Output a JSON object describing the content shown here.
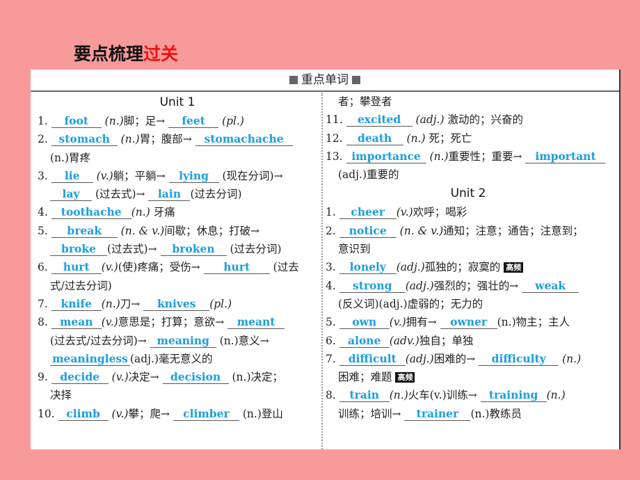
{
  "heading": {
    "black": "要点梳理",
    "red": "过关"
  },
  "section_title": "重点单词",
  "unit1": {
    "title": "Unit 1",
    "items": {
      "i1": {
        "num": "1.",
        "a": "foot",
        "pos": "(n.)",
        "meaning": "脚；足→",
        "b": "feet",
        "tail": "(pl.)"
      },
      "i2": {
        "num": "2.",
        "a": "stomach",
        "pos": "(n.)",
        "meaning": "胃；腹部→",
        "b": "stomachache",
        "cont": "(n.)胃疼"
      },
      "i3": {
        "num": "3.",
        "a": "lie",
        "pos": "(v.)",
        "meaning": "躺；平躺→",
        "b": "lying",
        "tail": "(现在分词)→",
        "c": "lay",
        "mid": "(过去式)→",
        "d": "lain",
        "tail2": "(过去分词)"
      },
      "i4": {
        "num": "4.",
        "a": "toothache",
        "pos": "(n.)",
        "meaning": "牙痛"
      },
      "i5": {
        "num": "5.",
        "a": "break",
        "pos": "(n. & v.)",
        "meaning": "间歇；休息；打破→",
        "b": "broke",
        "mid": "(过去式)→",
        "c": "broken",
        "tail": "(过去分词)"
      },
      "i6": {
        "num": "6.",
        "a": "hurt",
        "pos": "(v.)",
        "meaning": "(使)疼痛；受伤→",
        "b": "hurt",
        "tail": "(过去",
        "cont": "式/过去分词)"
      },
      "i7": {
        "num": "7.",
        "a": "knife",
        "pos": "(n.)",
        "meaning": "刀→",
        "b": "knives",
        "tail": "(pl.)"
      },
      "i8": {
        "num": "8.",
        "a": "mean",
        "pos": "(v.)",
        "meaning": "意思是；打算；意欲→",
        "b": "meant",
        "cont": "(过去式/过去分词)→",
        "c": "meaning",
        "mid": "(n.)意义→",
        "d": "meaningless",
        "tail2": "(adj.)毫无意义的"
      },
      "i9": {
        "num": "9.",
        "a": "decide",
        "pos": "(v.)",
        "meaning": "决定→",
        "b": "decision",
        "tail": "(n.)决定；",
        "cont": "决择"
      },
      "i10": {
        "num": "10.",
        "a": "climb",
        "pos": "(v.)",
        "meaning": "攀；爬→",
        "b": "climber",
        "tail": "(n.)登山",
        "cont": "者；攀登者"
      },
      "i11": {
        "num": "11.",
        "a": "excited",
        "pos": "(adj.)",
        "meaning": "激动的；兴奋的"
      },
      "i12": {
        "num": "12.",
        "a": "death",
        "pos": "(n.)",
        "meaning": "死；死亡"
      },
      "i13": {
        "num": "13.",
        "a": "importance",
        "pos": "(n.)",
        "meaning": "重要性；重要→",
        "b": "important",
        "cont": "(adj.)重要的"
      }
    }
  },
  "unit2": {
    "title": "Unit 2",
    "badge": "高频",
    "items": {
      "i1": {
        "num": "1.",
        "a": "cheer",
        "pos": "(v.)",
        "meaning": "欢呼；喝彩"
      },
      "i2": {
        "num": "2.",
        "a": "notice",
        "pos": "(n. & v.)",
        "meaning": "通知；注意；通告；注意到；",
        "cont": "意识到"
      },
      "i3": {
        "num": "3.",
        "a": "lonely",
        "pos": "(adj.)",
        "meaning": "孤独的；寂寞的"
      },
      "i4": {
        "num": "4.",
        "a": "strong",
        "pos": "(adj.)",
        "meaning": "强烈的；强壮的→",
        "b": "weak",
        "cont": "(反义词)(adj.)虚弱的；无力的"
      },
      "i5": {
        "num": "5.",
        "a": "own",
        "pos": "(v.)",
        "meaning": "拥有→",
        "b": "owner",
        "tail": "(n.)物主；主人"
      },
      "i6": {
        "num": "6.",
        "a": "alone",
        "pos": "(adv.)",
        "meaning": "独自；单独"
      },
      "i7": {
        "num": "7.",
        "a": "difficult",
        "pos": "(adj.)",
        "meaning": "困难的→",
        "b": "difficulty",
        "tail": "(n.)",
        "cont": "困难；难题"
      },
      "i8": {
        "num": "8.",
        "a": "train",
        "pos": "(n.)",
        "meaning": "火车(v.)训练→",
        "b": "training",
        "tail": "(n.)",
        "cont": "训练；培训→",
        "c": "trainer",
        "tail2": "(n.)教练员"
      }
    }
  }
}
